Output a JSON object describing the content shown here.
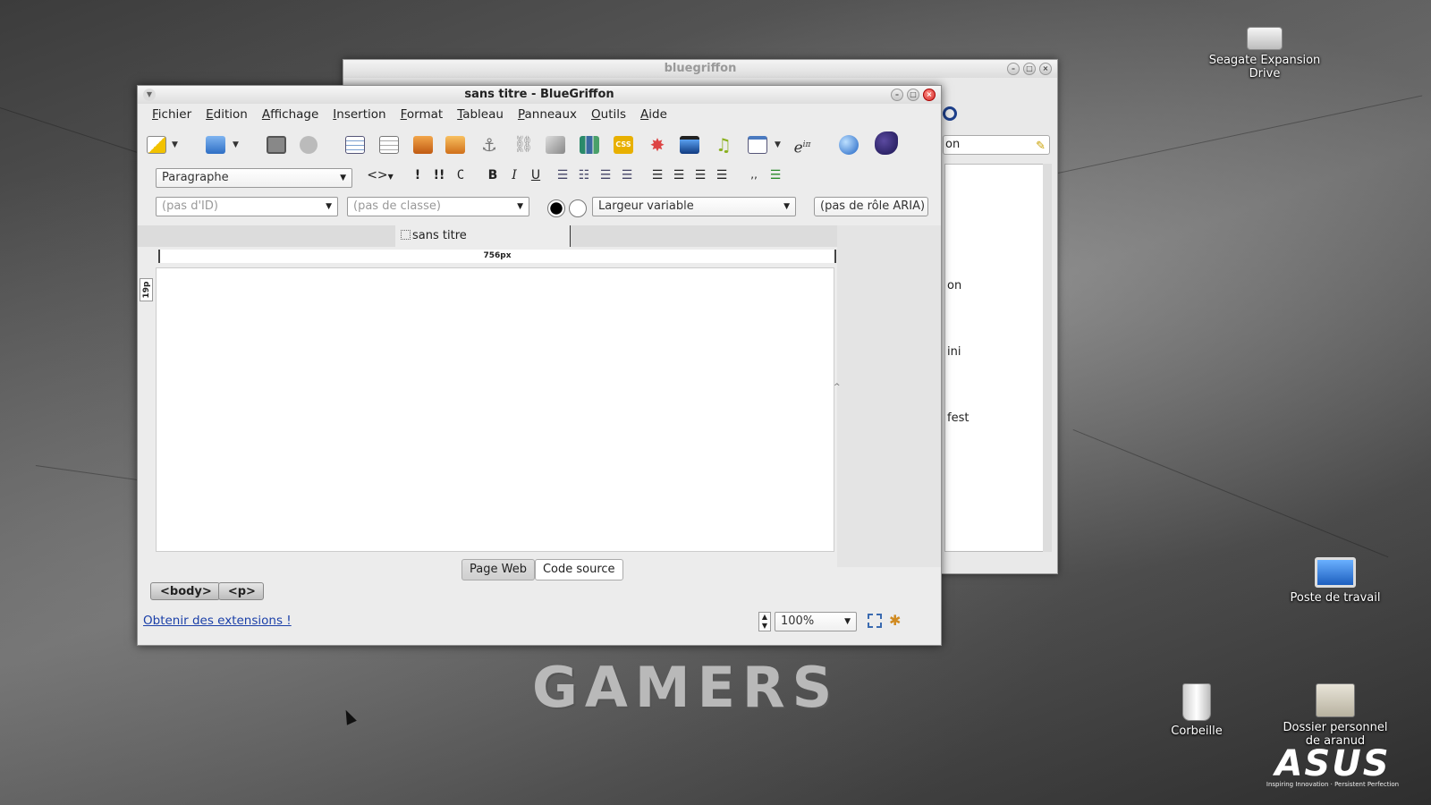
{
  "desktop": {
    "icons": [
      {
        "label": "Seagate Expansion Drive"
      },
      {
        "label": "Poste de travail"
      },
      {
        "label": "Corbeille"
      },
      {
        "label": "Dossier personnel de aranud"
      }
    ],
    "wallpaper_text": "GAMERS",
    "brand": "ASUS",
    "brand_tagline": "Inspiring Innovation · Persistent Perfection"
  },
  "bg_window": {
    "title": "bluegriffon",
    "search_value": "on",
    "list_fragments": [
      "on",
      "ini",
      "fest"
    ]
  },
  "window": {
    "title": "sans titre - BlueGriffon",
    "menu": [
      "Fichier",
      "Edition",
      "Affichage",
      "Insertion",
      "Format",
      "Tableau",
      "Panneaux",
      "Outils",
      "Aide"
    ],
    "paragraph_select": "Paragraphe",
    "id_select_placeholder": "(pas d'ID)",
    "class_select_placeholder": "(pas de classe)",
    "width_select": "Largeur variable",
    "aria_select": "(pas de rôle ARIA)",
    "format_buttons": {
      "bold": "B",
      "italic": "I",
      "underline": "U",
      "emph": "!",
      "strong": "!!",
      "code": "C"
    },
    "tab_label": "sans titre",
    "ruler_label": "756px",
    "vruler_label": "19p",
    "view_tabs": [
      "Page Web",
      "Code source"
    ],
    "breadcrumbs": [
      "<body>",
      "<p>"
    ],
    "extensions_link": "Obtenir des extensions !",
    "zoom": "100%"
  },
  "colors": {
    "accent_link": "#1a3fa8",
    "close_button": "#d32f2f"
  }
}
